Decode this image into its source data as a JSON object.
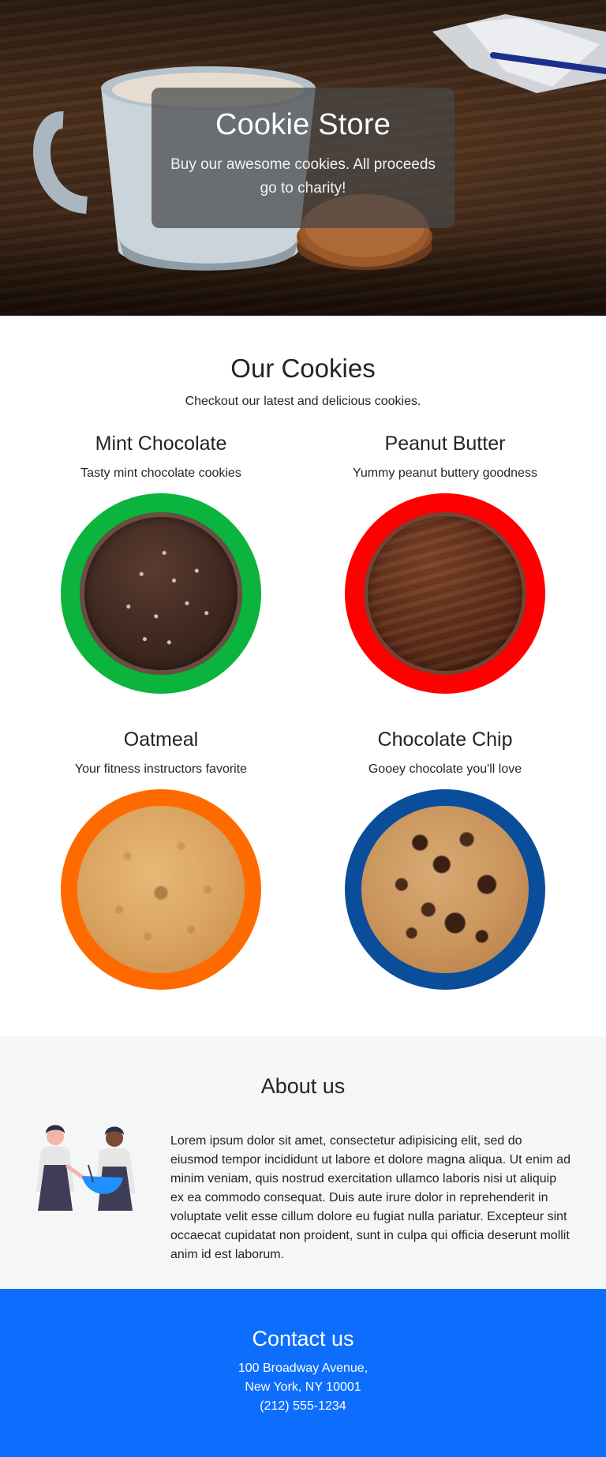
{
  "hero": {
    "title": "Cookie Store",
    "subtitle": "Buy our awesome cookies. All proceeds go to charity!"
  },
  "cookies_section": {
    "title": "Our Cookies",
    "subtitle": "Checkout our latest and delicious cookies.",
    "items": [
      {
        "name": "Mint Chocolate",
        "description": "Tasty mint chocolate cookies",
        "ring_color": "#0bb43d"
      },
      {
        "name": "Peanut Butter",
        "description": "Yummy peanut buttery goodness",
        "ring_color": "#ff0000"
      },
      {
        "name": "Oatmeal",
        "description": "Your fitness instructors favorite",
        "ring_color": "#ff6a00"
      },
      {
        "name": "Chocolate Chip",
        "description": "Gooey chocolate you'll love",
        "ring_color": "#0a4e9b"
      }
    ]
  },
  "about": {
    "title": "About us",
    "text": "Lorem ipsum dolor sit amet, consectetur adipisicing elit, sed do eiusmod tempor incididunt ut labore et dolore magna aliqua. Ut enim ad minim veniam, quis nostrud exercitation ullamco laboris nisi ut aliquip ex ea commodo consequat. Duis aute irure dolor in reprehenderit in voluptate velit esse cillum dolore eu fugiat nulla pariatur. Excepteur sint occaecat cupidatat non proident, sunt in culpa qui officia deserunt mollit anim id est laborum."
  },
  "contact": {
    "title": "Contact us",
    "address_line1": "100 Broadway Avenue,",
    "address_line2": "New York, NY 10001",
    "phone": "(212) 555-1234"
  },
  "colors": {
    "contact_background": "#0d6efd",
    "about_background": "#f5f6f7"
  }
}
